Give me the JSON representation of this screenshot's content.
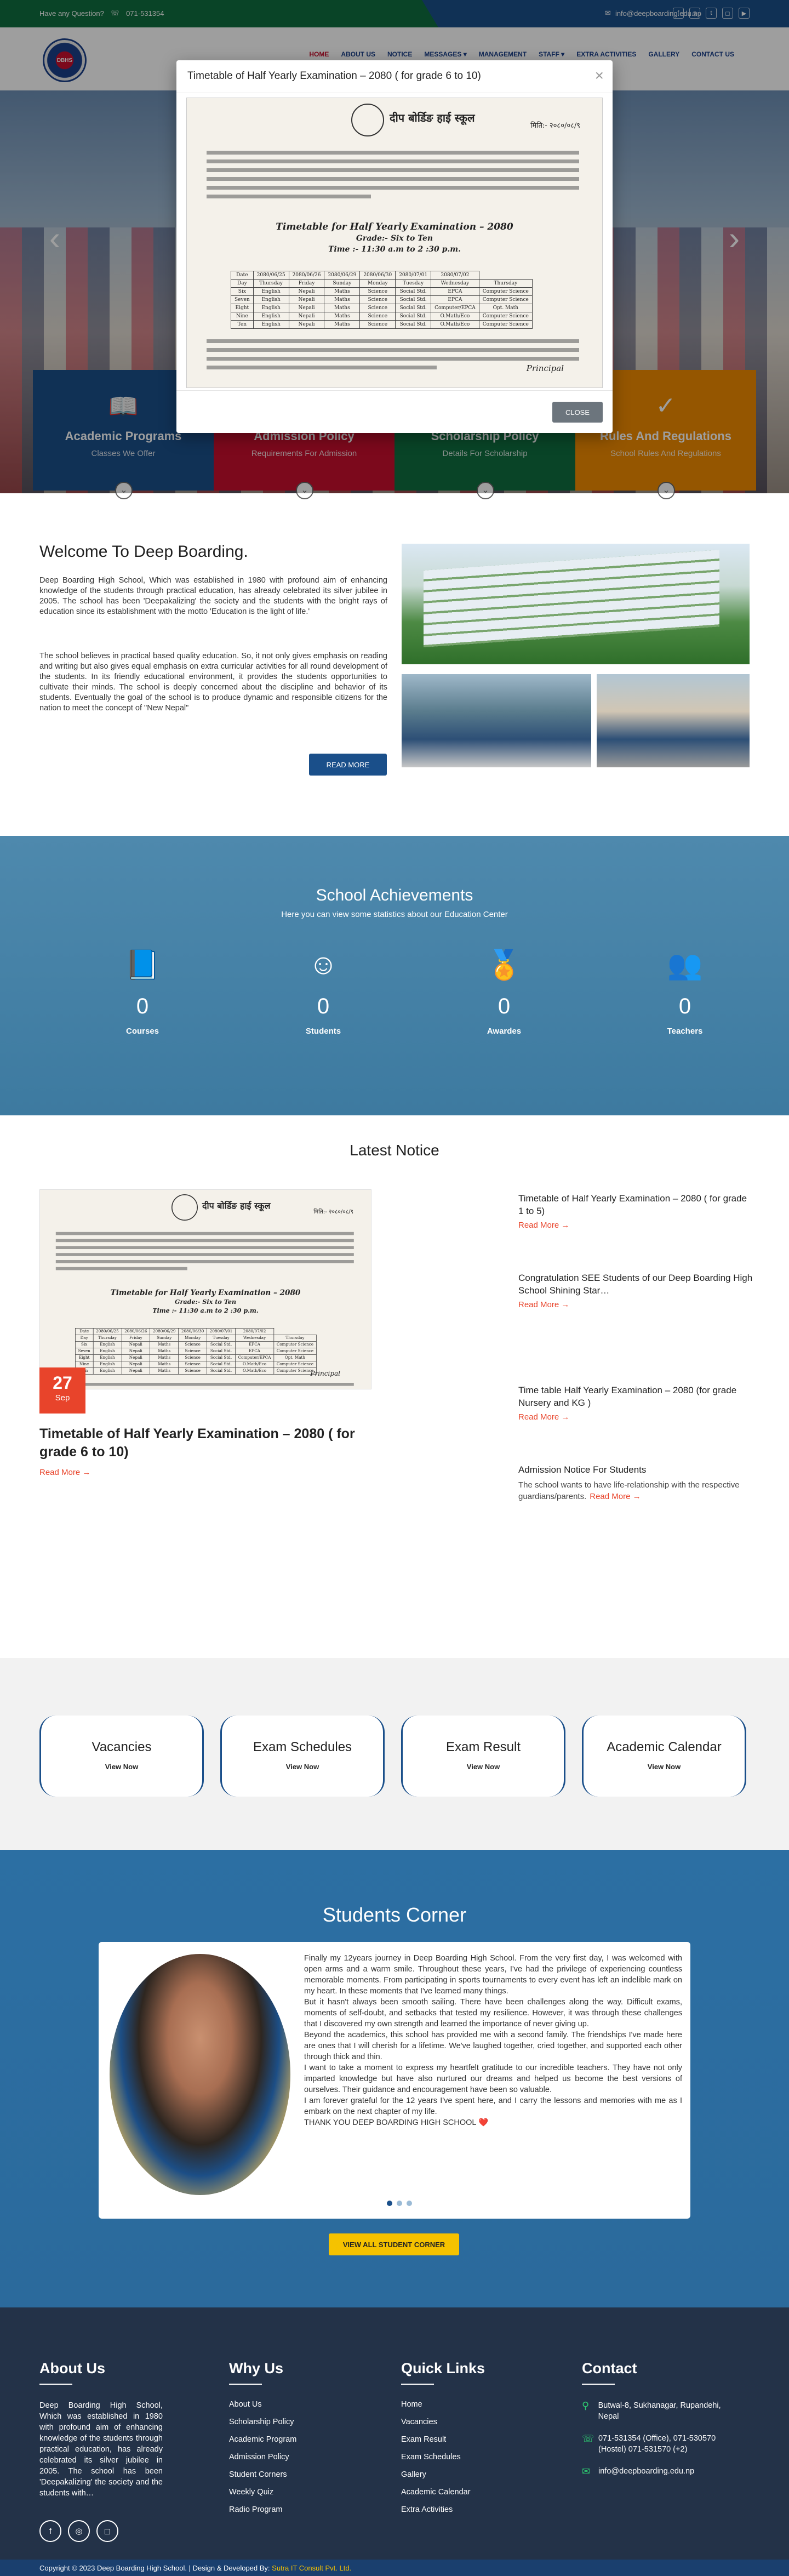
{
  "topbar": {
    "question": "Have any Question?",
    "phone": "071-531354",
    "email": "info@deepboarding.edu.np",
    "socials": [
      "facebook-icon",
      "viber-icon",
      "twitter-icon",
      "instagram-icon",
      "youtube-icon"
    ]
  },
  "nav": {
    "items": [
      "Home",
      "About Us",
      "Notice",
      "Messages ▾",
      "Management",
      "Staff ▾",
      "Extra Activities",
      "Gallery",
      "Contact Us"
    ]
  },
  "hero": {
    "prev": "‹",
    "next": "›",
    "features": [
      {
        "title": "Academic Programs",
        "sub": "Classes We Offer",
        "color": "#1a4f8a",
        "icon": "📖"
      },
      {
        "title": "Admission Policy",
        "sub": "Requirements For Admission",
        "color": "#c8102e",
        "icon": "📝"
      },
      {
        "title": "Scholarship Policy",
        "sub": "Details For Scholarship",
        "color": "#0f6e3f",
        "icon": "🎓"
      },
      {
        "title": "Rules And Regulations",
        "sub": "School Rules And Regulations",
        "color": "#f08c00",
        "icon": "✓"
      }
    ]
  },
  "modal": {
    "title": "Timetable of Half Yearly Examination – 2080 ( for grade 6 to 10)",
    "close_label": "CLOSE",
    "close_icon": "×",
    "doc": {
      "school": "दीप बोर्डिङ हाई स्कूल",
      "date": "मिति:- २०८०/०८/९",
      "title1": "Timetable for Half Yearly Examination – 2080",
      "title2": "Grade:- Six to Ten",
      "title3": "Time :- 11:30 a.m to 2 :30 p.m.",
      "table": [
        [
          "Date",
          "2080/06/25",
          "2080/06/26",
          "2080/06/29",
          "2080/06/30",
          "2080/07/01",
          "2080/07/02"
        ],
        [
          "Day",
          "Thursday",
          "Friday",
          "Sunday",
          "Monday",
          "Tuesday",
          "Wednesday",
          "Thursday"
        ],
        [
          "Six",
          "English",
          "Nepali",
          "Maths",
          "Science",
          "Social Std.",
          "EPCA",
          "Computer Science"
        ],
        [
          "Seven",
          "English",
          "Nepali",
          "Maths",
          "Science",
          "Social Std.",
          "EPCA",
          "Computer Science"
        ],
        [
          "Eight",
          "English",
          "Nepali",
          "Maths",
          "Science",
          "Social Std.",
          "Computer/EPCA",
          "Opt. Math"
        ],
        [
          "Nine",
          "English",
          "Nepali",
          "Maths",
          "Science",
          "Social Std.",
          "O.Math/Eco",
          "Computer Science"
        ],
        [
          "Ten",
          "English",
          "Nepali",
          "Maths",
          "Science",
          "Social Std.",
          "O.Math/Eco",
          "Computer Science"
        ]
      ],
      "signature": "Principal"
    }
  },
  "welcome": {
    "title": "Welcome To Deep Boarding.",
    "p1": "Deep Boarding High School, Which was established in 1980 with profound aim of enhancing knowledge of the students through practical education, has already celebrated its silver jubilee in 2005. The school has been 'Deepakalizing' the society and the students with the bright rays of education since its establishment with the motto 'Education is the light of life.'",
    "p2": "The school believes in practical based quality education. So, it not only gives emphasis on reading and writing but also gives equal emphasis on extra curricular activities for all round development of the students. In its friendly educational environment, it provides the students opportunities to cultivate their minds. The school is deeply concerned about the discipline and behavior of its students. Eventually the goal of the school is to produce dynamic and responsible citizens for the nation to meet the concept of \"New Nepal\"",
    "read_more": "READ MORE"
  },
  "achievements": {
    "title": "School Achievements",
    "subtitle": "Here you can view some statistics about our Education Center",
    "stats": [
      {
        "icon": "book-icon",
        "glyph": "📘",
        "value": "0",
        "label": "Courses"
      },
      {
        "icon": "smile-icon",
        "glyph": "☺",
        "value": "0",
        "label": "Students"
      },
      {
        "icon": "award-icon",
        "glyph": "🏅",
        "value": "0",
        "label": "Awardes"
      },
      {
        "icon": "teachers-icon",
        "glyph": "👥",
        "value": "0",
        "label": "Teachers"
      }
    ]
  },
  "notices": {
    "title": "Latest Notice",
    "main": {
      "day": "27",
      "month": "Sep",
      "title": "Timetable of Half Yearly Examination – 2080 ( for grade 6 to 10)",
      "link": "Read More →"
    },
    "side": [
      {
        "title": "Timetable of Half Yearly Examination – 2080 ( for grade 1 to 5)",
        "link": "Read More →"
      },
      {
        "title": "Congratulation SEE Students of our Deep Boarding High School Shining Star…",
        "link": "Read More →"
      },
      {
        "title": "Time table Half Yearly Examination – 2080 (for grade Nursery and KG )",
        "link": "Read More →"
      },
      {
        "title": "Admission Notice For Students",
        "text": "The school wants to have life-relationship with the respective guardians/parents.",
        "link": "Read More →"
      }
    ]
  },
  "quick": {
    "cards": [
      {
        "title": "Vacancies",
        "link": "View Now"
      },
      {
        "title": "Exam Schedules",
        "link": "View Now"
      },
      {
        "title": "Exam Result",
        "link": "View Now"
      },
      {
        "title": "Academic Calendar",
        "link": "View Now"
      }
    ]
  },
  "corner": {
    "title": "Students Corner",
    "story": [
      "Finally my 12years journey in Deep Boarding High School. From the very first day, I was welcomed with open arms and a warm smile. Throughout these years, I've had the privilege of experiencing countless memorable moments. From participating in sports tournaments to every event has left an indelible mark on my heart. In these moments that I've learned many things.",
      "But it hasn't always been smooth sailing. There have been challenges along the way. Difficult exams, moments of self-doubt, and setbacks that tested my resilience. However, it was through these challenges that I discovered my own strength and learned the importance of never giving up.",
      "Beyond the academics, this school has provided me with a second family. The friendships I've made here are ones that I will cherish for a lifetime. We've laughed together, cried together, and supported each other through thick and thin.",
      "I want to take a moment to express my heartfelt gratitude to our incredible teachers. They have not only imparted knowledge but have also nurtured our dreams and helped us become the best versions of ourselves. Their guidance and encouragement have been so valuable.",
      "I am forever grateful for the 12 years I've spent here, and I carry the lessons and memories with me as I embark on the next chapter of my life.",
      "THANK YOU DEEP BOARDING HIGH SCHOOL ❤️"
    ],
    "button": "VIEW ALL STUDENT CORNER"
  },
  "footer": {
    "about_title": "About Us",
    "about_text": "Deep Boarding High School, Which was established in 1980 with profound aim of enhancing knowledge of the students through practical education, has already celebrated its silver jubilee in 2005. The school has been 'Deepakalizing' the society and the students with…",
    "why_title": "Why Us",
    "why_items": [
      "About Us",
      "Scholarship Policy",
      "Academic Program",
      "Admission Policy",
      "Student Corners",
      "Weekly Quiz",
      "Radio Program"
    ],
    "links_title": "Quick Links",
    "link_items": [
      "Home",
      "Vacancies",
      "Exam Result",
      "Exam Schedules",
      "Gallery",
      "Academic Calendar",
      "Extra Activities"
    ],
    "contact_title": "Contact",
    "address": "Butwal-8, Sukhanagar, Rupandehi, Nepal",
    "phones": "071-531354 (Office), 071-530570 (Hostel) 071-531570 (+2)",
    "email": "info@deepboarding.edu.np",
    "copyright": "Copyright © 2023 Deep Boarding High School. | Design & Developed By:",
    "developer": "Sutra IT Consult Pvt. Ltd."
  }
}
